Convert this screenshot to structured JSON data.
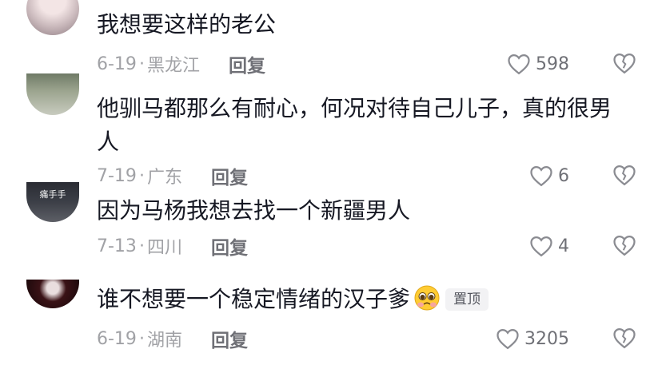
{
  "comments": [
    {
      "text": "我想要这样的老公",
      "date": "6-19",
      "location": "黑龙江",
      "reply": "回复",
      "likes": "598"
    },
    {
      "text": "他驯马都那么有耐心，何况对待自己儿子，真的很男人",
      "date": "7-19",
      "location": "广东",
      "reply": "回复",
      "likes": "6"
    },
    {
      "text": "因为马杨我想去找一个新疆男人",
      "date": "7-13",
      "location": "四川",
      "reply": "回复",
      "likes": "4",
      "avatar_text": "痛手手"
    },
    {
      "text": "谁不想要一个稳定情绪的汉子爹",
      "date": "6-19",
      "location": "湖南",
      "reply": "回复",
      "likes": "3205",
      "badge": "置顶",
      "emoji_icon": "pleading-face-icon"
    }
  ],
  "separator": "·",
  "icons": {
    "like": "heart-outline-icon",
    "dislike": "broken-heart-icon"
  },
  "colors": {
    "text": "#161823",
    "meta": "#a1a2a6",
    "reply": "#6f7076",
    "pin_bg": "#f2f2f4"
  }
}
